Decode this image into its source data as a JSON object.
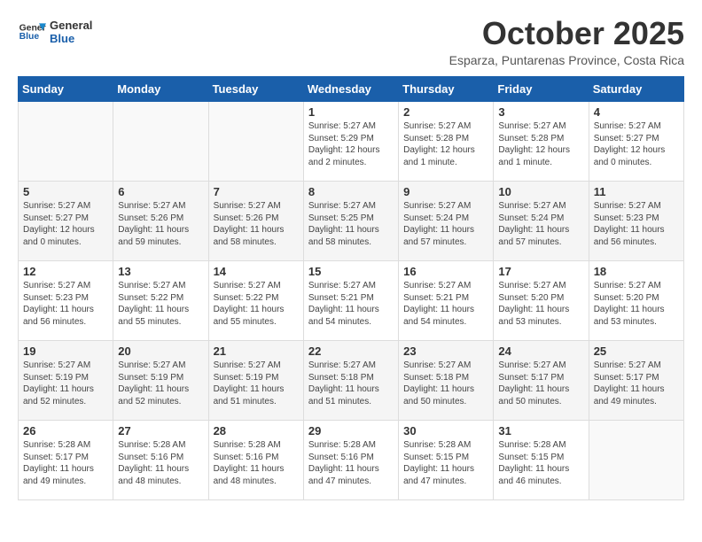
{
  "logo": {
    "line1": "General",
    "line2": "Blue"
  },
  "title": "October 2025",
  "subtitle": "Esparza, Puntarenas Province, Costa Rica",
  "days_of_week": [
    "Sunday",
    "Monday",
    "Tuesday",
    "Wednesday",
    "Thursday",
    "Friday",
    "Saturday"
  ],
  "weeks": [
    [
      {
        "day": "",
        "info": ""
      },
      {
        "day": "",
        "info": ""
      },
      {
        "day": "",
        "info": ""
      },
      {
        "day": "1",
        "info": "Sunrise: 5:27 AM\nSunset: 5:29 PM\nDaylight: 12 hours\nand 2 minutes."
      },
      {
        "day": "2",
        "info": "Sunrise: 5:27 AM\nSunset: 5:28 PM\nDaylight: 12 hours\nand 1 minute."
      },
      {
        "day": "3",
        "info": "Sunrise: 5:27 AM\nSunset: 5:28 PM\nDaylight: 12 hours\nand 1 minute."
      },
      {
        "day": "4",
        "info": "Sunrise: 5:27 AM\nSunset: 5:27 PM\nDaylight: 12 hours\nand 0 minutes."
      }
    ],
    [
      {
        "day": "5",
        "info": "Sunrise: 5:27 AM\nSunset: 5:27 PM\nDaylight: 12 hours\nand 0 minutes."
      },
      {
        "day": "6",
        "info": "Sunrise: 5:27 AM\nSunset: 5:26 PM\nDaylight: 11 hours\nand 59 minutes."
      },
      {
        "day": "7",
        "info": "Sunrise: 5:27 AM\nSunset: 5:26 PM\nDaylight: 11 hours\nand 58 minutes."
      },
      {
        "day": "8",
        "info": "Sunrise: 5:27 AM\nSunset: 5:25 PM\nDaylight: 11 hours\nand 58 minutes."
      },
      {
        "day": "9",
        "info": "Sunrise: 5:27 AM\nSunset: 5:24 PM\nDaylight: 11 hours\nand 57 minutes."
      },
      {
        "day": "10",
        "info": "Sunrise: 5:27 AM\nSunset: 5:24 PM\nDaylight: 11 hours\nand 57 minutes."
      },
      {
        "day": "11",
        "info": "Sunrise: 5:27 AM\nSunset: 5:23 PM\nDaylight: 11 hours\nand 56 minutes."
      }
    ],
    [
      {
        "day": "12",
        "info": "Sunrise: 5:27 AM\nSunset: 5:23 PM\nDaylight: 11 hours\nand 56 minutes."
      },
      {
        "day": "13",
        "info": "Sunrise: 5:27 AM\nSunset: 5:22 PM\nDaylight: 11 hours\nand 55 minutes."
      },
      {
        "day": "14",
        "info": "Sunrise: 5:27 AM\nSunset: 5:22 PM\nDaylight: 11 hours\nand 55 minutes."
      },
      {
        "day": "15",
        "info": "Sunrise: 5:27 AM\nSunset: 5:21 PM\nDaylight: 11 hours\nand 54 minutes."
      },
      {
        "day": "16",
        "info": "Sunrise: 5:27 AM\nSunset: 5:21 PM\nDaylight: 11 hours\nand 54 minutes."
      },
      {
        "day": "17",
        "info": "Sunrise: 5:27 AM\nSunset: 5:20 PM\nDaylight: 11 hours\nand 53 minutes."
      },
      {
        "day": "18",
        "info": "Sunrise: 5:27 AM\nSunset: 5:20 PM\nDaylight: 11 hours\nand 53 minutes."
      }
    ],
    [
      {
        "day": "19",
        "info": "Sunrise: 5:27 AM\nSunset: 5:19 PM\nDaylight: 11 hours\nand 52 minutes."
      },
      {
        "day": "20",
        "info": "Sunrise: 5:27 AM\nSunset: 5:19 PM\nDaylight: 11 hours\nand 52 minutes."
      },
      {
        "day": "21",
        "info": "Sunrise: 5:27 AM\nSunset: 5:19 PM\nDaylight: 11 hours\nand 51 minutes."
      },
      {
        "day": "22",
        "info": "Sunrise: 5:27 AM\nSunset: 5:18 PM\nDaylight: 11 hours\nand 51 minutes."
      },
      {
        "day": "23",
        "info": "Sunrise: 5:27 AM\nSunset: 5:18 PM\nDaylight: 11 hours\nand 50 minutes."
      },
      {
        "day": "24",
        "info": "Sunrise: 5:27 AM\nSunset: 5:17 PM\nDaylight: 11 hours\nand 50 minutes."
      },
      {
        "day": "25",
        "info": "Sunrise: 5:27 AM\nSunset: 5:17 PM\nDaylight: 11 hours\nand 49 minutes."
      }
    ],
    [
      {
        "day": "26",
        "info": "Sunrise: 5:28 AM\nSunset: 5:17 PM\nDaylight: 11 hours\nand 49 minutes."
      },
      {
        "day": "27",
        "info": "Sunrise: 5:28 AM\nSunset: 5:16 PM\nDaylight: 11 hours\nand 48 minutes."
      },
      {
        "day": "28",
        "info": "Sunrise: 5:28 AM\nSunset: 5:16 PM\nDaylight: 11 hours\nand 48 minutes."
      },
      {
        "day": "29",
        "info": "Sunrise: 5:28 AM\nSunset: 5:16 PM\nDaylight: 11 hours\nand 47 minutes."
      },
      {
        "day": "30",
        "info": "Sunrise: 5:28 AM\nSunset: 5:15 PM\nDaylight: 11 hours\nand 47 minutes."
      },
      {
        "day": "31",
        "info": "Sunrise: 5:28 AM\nSunset: 5:15 PM\nDaylight: 11 hours\nand 46 minutes."
      },
      {
        "day": "",
        "info": ""
      }
    ]
  ]
}
